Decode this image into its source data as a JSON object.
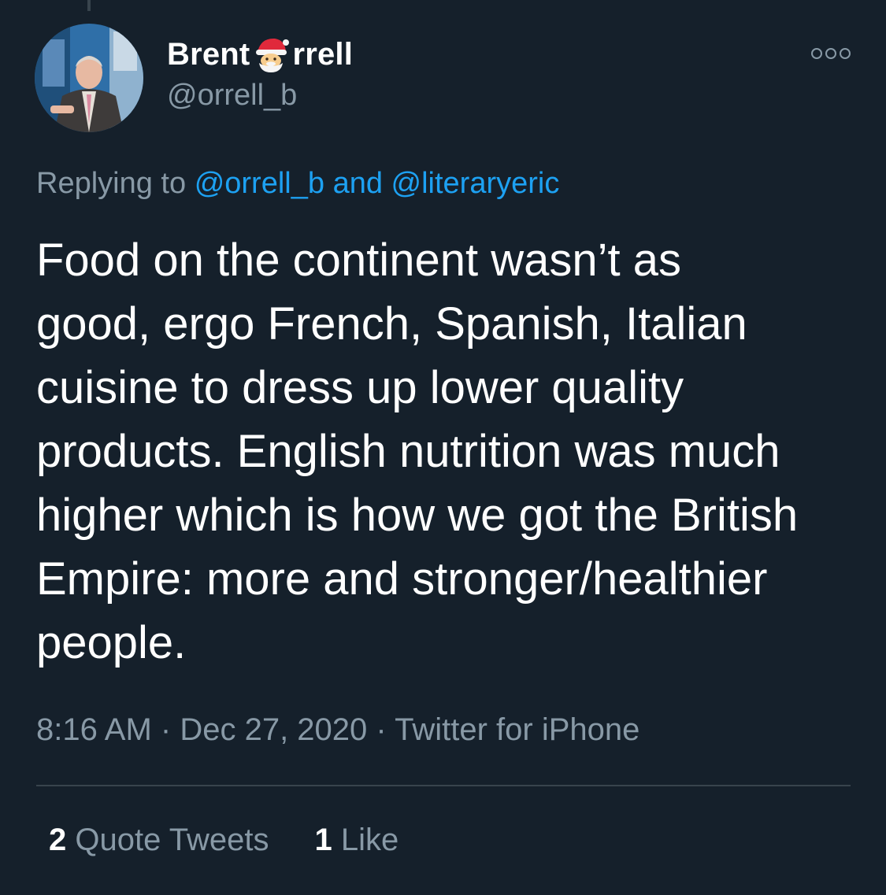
{
  "author": {
    "name_before_emoji": "Brent",
    "name_after_emoji": "rrell",
    "name_emoji": "santa-claus-emoji",
    "handle": "@orrell_b"
  },
  "reply_context": {
    "prefix": "Replying to",
    "mention_1": "@orrell_b",
    "conjunction": "and",
    "mention_2": "@literaryeric"
  },
  "tweet": {
    "text": "Food on the continent wasn’t as\ngood, ergo French, Spanish, Italian\ncuisine to dress up lower quality\nproducts. English nutrition was much\nhigher which is how we got the British\nEmpire: more and stronger/healthier\npeople."
  },
  "meta": {
    "time": "8:16 AM",
    "date": "Dec 27, 2020",
    "source": "Twitter for iPhone",
    "separator": "·"
  },
  "stats": {
    "quote_count": "2",
    "quote_label": "Quote Tweets",
    "like_count": "1",
    "like_label": "Like"
  },
  "colors": {
    "background": "#15202b",
    "text": "#ffffff",
    "secondary": "#8899a6",
    "link": "#1da1f2",
    "divider": "#38444d"
  }
}
